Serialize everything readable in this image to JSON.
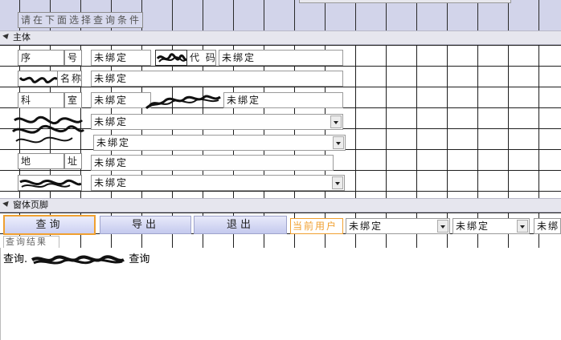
{
  "header": {
    "prompt": "请在下面选择查询条件"
  },
  "sections": {
    "main": "主体",
    "footer": "窗体页脚"
  },
  "fields": {
    "seq_label_a": "序",
    "seq_label_b": "号",
    "seq_value": "未绑定",
    "code_label": "代 码",
    "code_value": "未绑定",
    "name_label": "名称",
    "name_value": "未绑定",
    "dept_label_a": "科",
    "dept_label_b": "室",
    "dept_value": "未绑定",
    "dept_extra_value": "未绑定",
    "row4_value": "未绑定",
    "row5_value": "未绑定",
    "addr_label_a": "地",
    "addr_label_b": "址",
    "addr_value": "未绑定",
    "row7_value": "未绑定"
  },
  "footer": {
    "query_button": "查询",
    "export_button": "导出",
    "exit_button": "退出",
    "current_user_label": "当前用户",
    "user_combo_value": "未绑定",
    "combo2_value": "未绑定",
    "combo3_value": "未绑"
  },
  "result": {
    "caption": "查询结果",
    "status_prefix": "查询.",
    "status_suffix": "查询"
  }
}
